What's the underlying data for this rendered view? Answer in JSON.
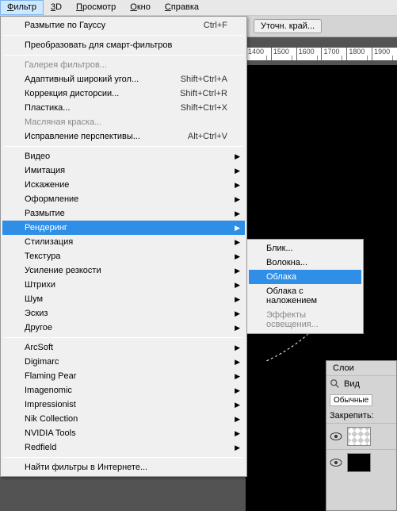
{
  "menubar": {
    "items": [
      {
        "label": "Фильтр",
        "ul": "Ф",
        "active": true
      },
      {
        "label": "3D",
        "ul": "3"
      },
      {
        "label": "Просмотр",
        "ul": "П"
      },
      {
        "label": "Окно",
        "ul": "О"
      },
      {
        "label": "Справка",
        "ul": "С"
      }
    ]
  },
  "toolbar": {
    "refine_edge": "Уточн. край..."
  },
  "ruler": {
    "marks": [
      "1400",
      "1500",
      "1600",
      "1700",
      "1800",
      "1900"
    ]
  },
  "filter_menu": {
    "last_filter": {
      "label": "Размытие по Гауссу",
      "shortcut": "Ctrl+F"
    },
    "convert_smart": "Преобразовать для смарт-фильтров",
    "gallery": "Галерея фильтров...",
    "adaptive_wide": {
      "label": "Адаптивный широкий угол...",
      "shortcut": "Shift+Ctrl+A"
    },
    "lens": {
      "label": "Коррекция дисторсии...",
      "shortcut": "Shift+Ctrl+R"
    },
    "liquify": {
      "label": "Пластика...",
      "shortcut": "Shift+Ctrl+X"
    },
    "oil": "Масляная краска...",
    "vanishing": {
      "label": "Исправление перспективы...",
      "shortcut": "Alt+Ctrl+V"
    },
    "groups": [
      "Видео",
      "Имитация",
      "Искажение",
      "Оформление",
      "Размытие",
      "Рендеринг",
      "Стилизация",
      "Текстура",
      "Усиление резкости",
      "Штрихи",
      "Шум",
      "Эскиз",
      "Другое"
    ],
    "plugins": [
      "ArcSoft",
      "Digimarc",
      "Flaming Pear",
      "Imagenomic",
      "Impressionist",
      "Nik Collection",
      "NVIDIA Tools",
      "Redfield"
    ],
    "browse": "Найти фильтры в Интернете..."
  },
  "render_submenu": {
    "items": [
      {
        "label": "Блик..."
      },
      {
        "label": "Волокна..."
      },
      {
        "label": "Облака",
        "highlight": true
      },
      {
        "label": "Облака с наложением"
      },
      {
        "label": "Эффекты освещения...",
        "disabled": true
      }
    ]
  },
  "layers": {
    "title": "Слои",
    "kind": "Вид",
    "mode": "Обычные",
    "lock_label": "Закрепить:"
  }
}
